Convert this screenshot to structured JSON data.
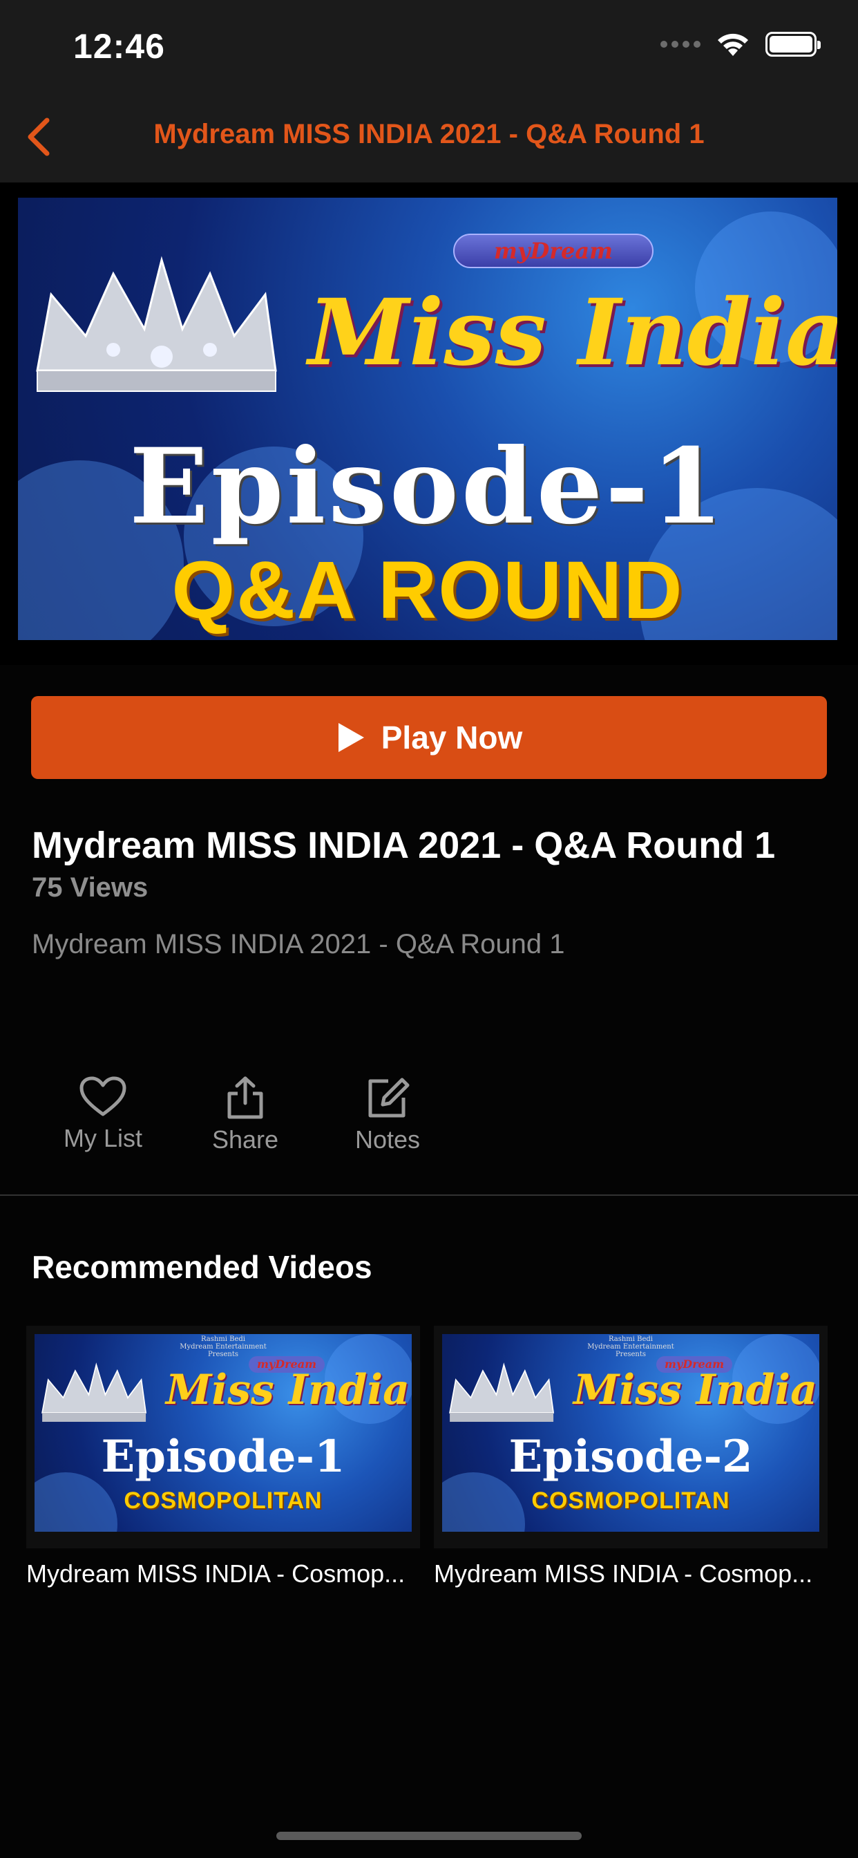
{
  "status_bar": {
    "time": "12:46"
  },
  "nav": {
    "title": "Mydream MISS INDIA 2021 - Q&A Round 1"
  },
  "hero": {
    "logo_text": "myDream",
    "line1": "Miss India",
    "line2": "Episode-1",
    "line3": "Q&A ROUND"
  },
  "play_button": {
    "label": "Play Now"
  },
  "video": {
    "title": "Mydream MISS INDIA 2021 - Q&A Round 1",
    "views": "75 Views",
    "description": "Mydream MISS INDIA 2021 - Q&A Round 1"
  },
  "actions": [
    {
      "label": "My List",
      "icon": "heart-icon"
    },
    {
      "label": "Share",
      "icon": "share-icon"
    },
    {
      "label": "Notes",
      "icon": "edit-icon"
    }
  ],
  "recommended": {
    "heading": "Recommended Videos",
    "items": [
      {
        "title": "Mydream MISS INDIA - Cosmop...",
        "thumb_small_text": "Rashmi Bedi\nMydream Entertainment\nPresents",
        "thumb_logo": "myDream",
        "thumb_line1": "Miss India",
        "thumb_line2": "Episode-1",
        "thumb_line3": "COSMOPOLITAN"
      },
      {
        "title": "Mydream MISS INDIA - Cosmop...",
        "thumb_small_text": "Rashmi Bedi\nMydream Entertainment\nPresents",
        "thumb_logo": "myDream",
        "thumb_line1": "Miss India",
        "thumb_line2": "Episode-2",
        "thumb_line3": "COSMOPOLITAN"
      }
    ]
  },
  "colors": {
    "accent": "#d94d14",
    "nav_title": "#e2561a",
    "background": "#040404"
  }
}
